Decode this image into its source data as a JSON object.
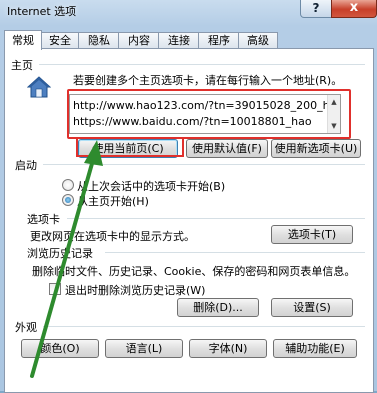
{
  "window": {
    "title": "Internet 选项",
    "help": "?",
    "close": "x"
  },
  "tabs": [
    "常规",
    "安全",
    "隐私",
    "内容",
    "连接",
    "程序",
    "高级"
  ],
  "homepage": {
    "section_title": "主页",
    "description": "若要创建多个主页选项卡，请在每行输入一个地址(R)。",
    "urls": [
      "http://www.hao123.com/?tn=39015028_200_hao",
      "https://www.baidu.com/?tn=10018801_hao"
    ],
    "use_current": "使用当前页(C)",
    "use_default": "使用默认值(F)",
    "use_new_tab": "使用新选项卡(U)"
  },
  "startup": {
    "section_title": "启动",
    "option_last_session": "从上次会话中的选项卡开始(B)",
    "option_homepage": "从主页开始(H)",
    "selected": "option_homepage"
  },
  "tabs_section": {
    "section_title": "选项卡",
    "description": "更改网页在选项卡中的显示方式。",
    "button": "选项卡(T)"
  },
  "history": {
    "section_title": "浏览历史记录",
    "description": "删除临时文件、历史记录、Cookie、保存的密码和网页表单信息。",
    "delete_on_exit": "退出时删除浏览历史记录(W)",
    "delete_on_exit_checked": false,
    "delete_button": "删除(D)...",
    "settings_button": "设置(S)"
  },
  "appearance": {
    "section_title": "外观",
    "colors": "颜色(O)",
    "languages": "语言(L)",
    "fonts": "字体(N)",
    "accessibility": "辅助功能(E)"
  },
  "colors": {
    "highlight_red": "#e0302c",
    "arrow_green": "#2e8b2e"
  }
}
